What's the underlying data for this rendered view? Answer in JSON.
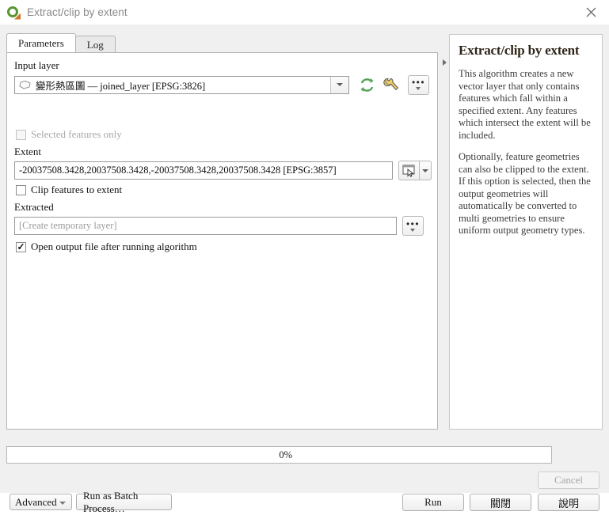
{
  "window": {
    "title": "Extract/clip by extent",
    "logo_icon": "qgis-logo",
    "close_icon": "close-icon"
  },
  "tabs": [
    {
      "label": "Parameters",
      "active": true
    },
    {
      "label": "Log",
      "active": false
    }
  ],
  "parameters": {
    "input_layer": {
      "label": "Input layer",
      "value": "變形熱區圖 — joined_layer [EPSG:3826]",
      "layer_icon": "polygon-layer-icon",
      "dropdown_icon": "chevron-down-icon",
      "iterate_icon": "iterate-refresh-icon",
      "advanced_icon": "wrench-icon",
      "more_icon": "ellipsis-icon"
    },
    "selected_features_only": {
      "label": "Selected features only",
      "checked": false,
      "disabled": true
    },
    "extent": {
      "label": "Extent",
      "value": "-20037508.3428,20037508.3428,-20037508.3428,20037508.3428 [EPSG:3857]",
      "picker_icon": "map-extent-select-icon",
      "dropdown_icon": "chevron-down-icon"
    },
    "clip_features_to_extent": {
      "label": "Clip features to extent",
      "checked": false
    },
    "extracted": {
      "label": "Extracted",
      "placeholder": "[Create temporary layer]",
      "value": "",
      "browse_icon": "ellipsis-icon"
    },
    "open_output_after_run": {
      "label": "Open output file after running algorithm",
      "checked": true,
      "check_glyph": "✓"
    }
  },
  "splitter": {
    "icon": "collapse-panel-arrow-icon"
  },
  "help": {
    "title": "Extract/clip by extent",
    "paragraphs": [
      "This algorithm creates a new vector layer that only contains features which fall within a specified extent. Any features which intersect the extent will be included.",
      "Optionally, feature geometries can also be clipped to the extent. If this option is selected, then the output geometries will automatically be converted to multi geometries to ensure uniform output geometry types."
    ]
  },
  "progress": {
    "value": 0,
    "text": "0%"
  },
  "buttons": {
    "advanced": "Advanced",
    "run_as_batch": "Run as Batch Process…",
    "cancel": "Cancel",
    "run": "Run",
    "close": "關閉",
    "help": "說明"
  },
  "colors": {
    "dialog_bg": "#f0f0f0",
    "panel_bg": "#ffffff",
    "accent_green": "#589632",
    "accent_orange": "#d4742a",
    "border": "#b4b4b4",
    "disabled_text": "#a8a8a8"
  }
}
